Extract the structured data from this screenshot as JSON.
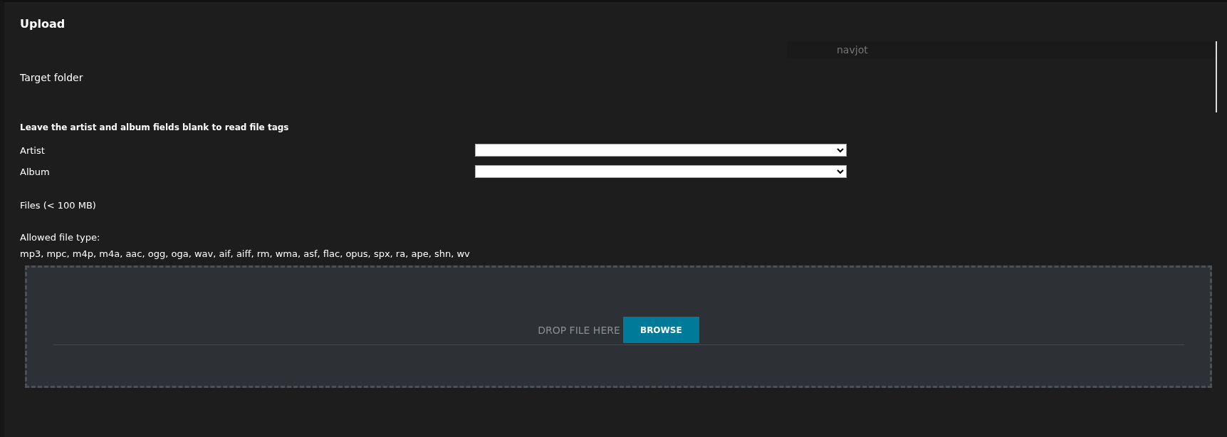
{
  "panel": {
    "title": "Upload"
  },
  "target_folder": {
    "label": "Target folder",
    "value": "navjot"
  },
  "note": "Leave the artist and album fields blank to read file tags",
  "fields": [
    {
      "label": "Artist"
    },
    {
      "label": "Album"
    }
  ],
  "files_label": "Files (< 100 MB)",
  "allowed": {
    "label": "Allowed file type:",
    "types": "mp3, mpc, m4p, m4a, aac, ogg, oga, wav, aif, aiff, rm, wma, asf, flac, opus, spx, ra, ape, shn, wv"
  },
  "dropzone": {
    "text": "DROP FILE HERE",
    "button": "BROWSE"
  }
}
